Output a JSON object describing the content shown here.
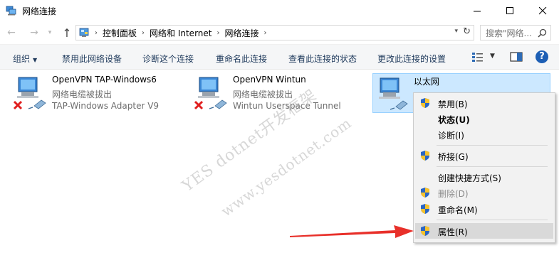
{
  "window": {
    "title": "网络连接"
  },
  "nav": {
    "breadcrumbs": [
      "控制面板",
      "网络和 Internet",
      "网络连接"
    ],
    "search_placeholder": "搜索\"网络..."
  },
  "toolbar": {
    "organize": "组织",
    "disable": "禁用此网络设备",
    "diagnose": "诊断这个连接",
    "rename": "重命名此连接",
    "view_status": "查看此连接的状态",
    "change_settings": "更改此连接的设置",
    "help": "?"
  },
  "connections": [
    {
      "name": "OpenVPN TAP-Windows6",
      "state": "网络电缆被拔出",
      "adapter": "TAP-Windows Adapter V9",
      "disconnected": true
    },
    {
      "name": "OpenVPN Wintun",
      "state": "网络电缆被拔出",
      "adapter": "Wintun Userspace Tunnel",
      "disconnected": true
    },
    {
      "name": "以太网",
      "state": "",
      "adapter": "",
      "selected": true
    }
  ],
  "context_menu": {
    "items": [
      {
        "label": "禁用(B)",
        "shield": true
      },
      {
        "label": "状态(U)",
        "bold": true
      },
      {
        "label": "诊断(I)"
      },
      {
        "label": "桥接(G)",
        "shield": true
      },
      {
        "label": "创建快捷方式(S)"
      },
      {
        "label": "删除(D)",
        "shield": true,
        "disabled": true
      },
      {
        "label": "重命名(M)",
        "shield": true
      },
      {
        "label": "属性(R)",
        "shield": true,
        "highlighted": true
      }
    ]
  },
  "watermark": {
    "line1": "YES dotnet开发框架",
    "line2": "www.yesdotnet.com"
  },
  "colors": {
    "accent": "#1d5fb5",
    "selection": "#cce8ff",
    "arrow": "#e8302a"
  }
}
